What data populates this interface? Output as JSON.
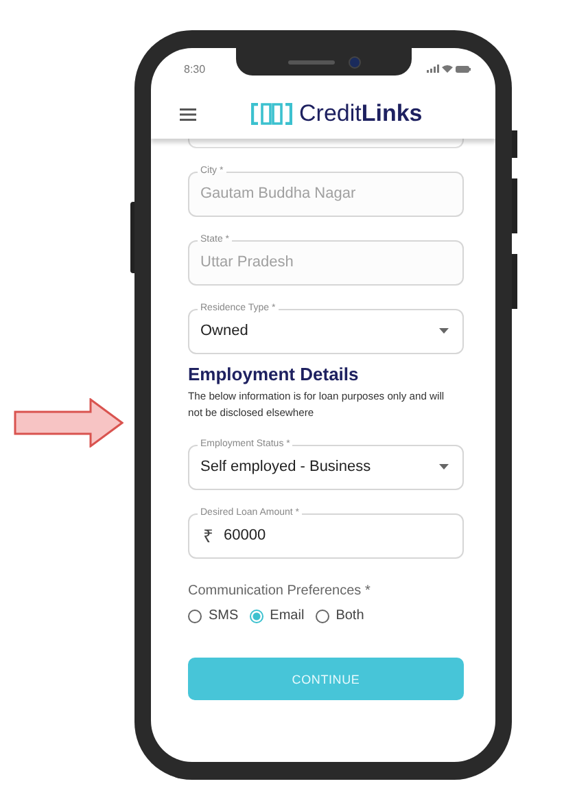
{
  "status_bar": {
    "time": "8:30"
  },
  "header": {
    "logo": "Credit**Links**"
  },
  "address_fields": [
    {
      "kind": "text",
      "label": "City *",
      "value": "Gautam Buddha Nagar",
      "disabled": true
    },
    {
      "kind": "text",
      "label": "State *",
      "value": "Uttar Pradesh",
      "disabled": true
    },
    {
      "kind": "select",
      "label": "Residence Type *",
      "value": "Owned",
      "disabled": false
    }
  ],
  "employment": {
    "heading": "Employment Details",
    "description": "The below information is for loan purposes only and will not be disclosed elsewhere",
    "fields": [
      {
        "kind": "select",
        "label": "Employment Status *",
        "value": "Self employed - Business",
        "disabled": false
      },
      {
        "kind": "currency",
        "label": "Desired Loan Amount *",
        "prefix": "₹",
        "value": "60000",
        "disabled": false
      }
    ]
  },
  "communication": {
    "label": "Communication Preferences *",
    "options": [
      {
        "label": "SMS",
        "selected": false
      },
      {
        "label": "Email",
        "selected": true
      },
      {
        "label": "Both",
        "selected": false
      }
    ]
  },
  "continue_button": "CONTINUE"
}
